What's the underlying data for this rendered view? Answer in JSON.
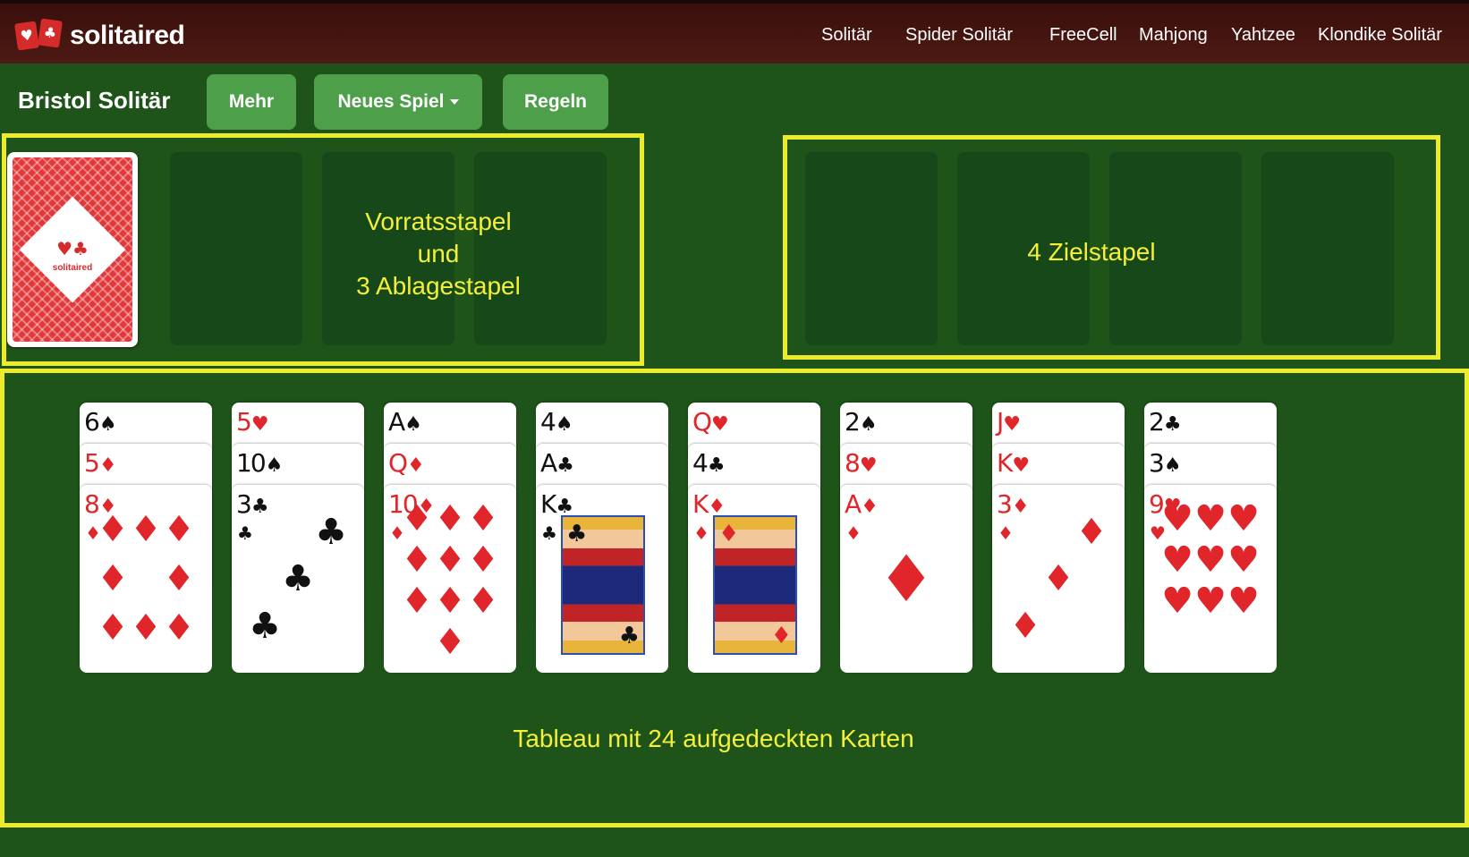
{
  "navbar": {
    "logo_text": "solitaired",
    "links": [
      "Solitär",
      "Spider Solitär",
      "FreeCell",
      "Mahjong",
      "Yahtzee",
      "Klondike Solitär"
    ]
  },
  "toolbar": {
    "title": "Bristol Solitär",
    "more_label": "Mehr",
    "new_game_label": "Neues Spiel",
    "rules_label": "Regeln"
  },
  "annotations": {
    "stock_label": "Vorratsstapel\nund\n3 Ablagestapel",
    "foundation_label": "4 Zielstapel",
    "tableau_label": "Tableau mit 24 aufgedeckten Karten"
  },
  "stock_card_text": "solitaired",
  "colors": {
    "felt": "#1e5319",
    "highlight": "#ecec2a",
    "button": "#4d9f4a",
    "navbar": "#4d1a14",
    "card_red": "#e0262a"
  },
  "tableau": [
    [
      {
        "rank": "6",
        "suit": "♠"
      },
      {
        "rank": "5",
        "suit": "♦"
      },
      {
        "rank": "8",
        "suit": "♦"
      }
    ],
    [
      {
        "rank": "5",
        "suit": "♥"
      },
      {
        "rank": "10",
        "suit": "♠"
      },
      {
        "rank": "3",
        "suit": "♣"
      }
    ],
    [
      {
        "rank": "A",
        "suit": "♠"
      },
      {
        "rank": "Q",
        "suit": "♦"
      },
      {
        "rank": "10",
        "suit": "♦"
      }
    ],
    [
      {
        "rank": "4",
        "suit": "♠"
      },
      {
        "rank": "A",
        "suit": "♣"
      },
      {
        "rank": "K",
        "suit": "♣"
      }
    ],
    [
      {
        "rank": "Q",
        "suit": "♥"
      },
      {
        "rank": "4",
        "suit": "♣"
      },
      {
        "rank": "K",
        "suit": "♦"
      }
    ],
    [
      {
        "rank": "2",
        "suit": "♠"
      },
      {
        "rank": "8",
        "suit": "♥"
      },
      {
        "rank": "A",
        "suit": "♦"
      }
    ],
    [
      {
        "rank": "J",
        "suit": "♥"
      },
      {
        "rank": "K",
        "suit": "♥"
      },
      {
        "rank": "3",
        "suit": "♦"
      }
    ],
    [
      {
        "rank": "2",
        "suit": "♣"
      },
      {
        "rank": "3",
        "suit": "♠"
      },
      {
        "rank": "9",
        "suit": "♥"
      }
    ]
  ]
}
